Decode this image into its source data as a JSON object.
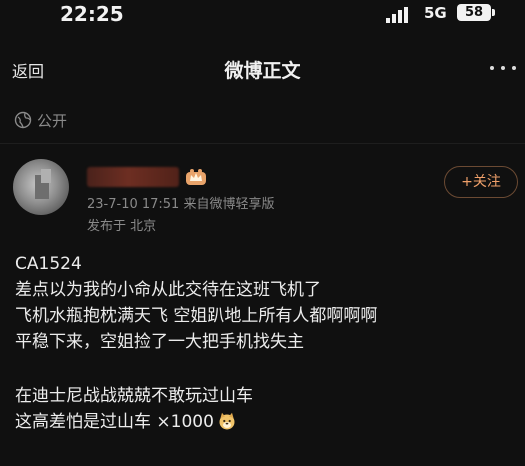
{
  "status_bar": {
    "time": "22:25",
    "network": "5G",
    "battery": "58"
  },
  "nav": {
    "back_label": "返回",
    "title": "微博正文",
    "more_icon": "more-dots-icon"
  },
  "visibility": {
    "icon": "globe-icon",
    "label": "公开"
  },
  "author": {
    "avatar": "blurred-avatar",
    "name_redacted": true,
    "badge_icon": "vip-crown-icon",
    "meta": "23-7-10 17:51  来自微博轻享版",
    "location": "发布于 北京",
    "follow_label": "+关注"
  },
  "post": {
    "lines": [
      "CA1524",
      "差点以为我的小命从此交待在这班飞机了",
      "飞机水瓶抱枕满天飞  空姐趴地上所有人都啊啊啊",
      "平稳下来，空姐捡了一大把手机找失主",
      "",
      "在迪士尼战战兢兢不敢玩过山车",
      "这高差怕是过山车 ×1000"
    ],
    "final_emoji": "doge-emoji-icon"
  },
  "colors": {
    "background": "#101010",
    "accent": "#f0a06a",
    "muted": "#8a8a8a"
  }
}
